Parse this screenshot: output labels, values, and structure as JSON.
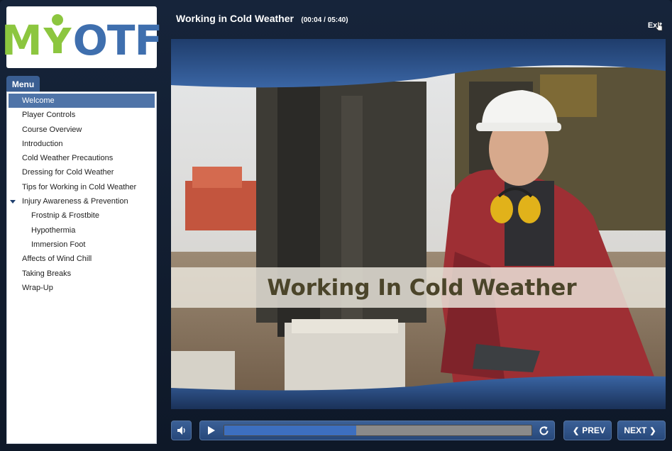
{
  "logo": {
    "text_m": "M",
    "text_y": "Y",
    "text_otf": "OTF"
  },
  "menu": {
    "tab_label": "Menu",
    "items": [
      {
        "label": "Welcome",
        "level": 0,
        "active": true
      },
      {
        "label": "Player Controls",
        "level": 0
      },
      {
        "label": "Course Overview",
        "level": 0
      },
      {
        "label": "Introduction",
        "level": 0
      },
      {
        "label": "Cold Weather Precautions",
        "level": 0
      },
      {
        "label": "Dressing for Cold Weather",
        "level": 0
      },
      {
        "label": "Tips for Working in Cold Weather",
        "level": 0
      },
      {
        "label": "Injury Awareness & Prevention",
        "level": 0,
        "expanded": true
      },
      {
        "label": "Frostnip & Frostbite",
        "level": 1
      },
      {
        "label": "Hypothermia",
        "level": 1
      },
      {
        "label": "Immersion Foot",
        "level": 1
      },
      {
        "label": "Affects of Wind Chill",
        "level": 0
      },
      {
        "label": "Taking Breaks",
        "level": 0
      },
      {
        "label": "Wrap-Up",
        "level": 0
      }
    ]
  },
  "header": {
    "title": "Working in Cold Weather",
    "timer": "(00:04 / 05:40)",
    "exit_label": "Exit"
  },
  "slide": {
    "banner_title": "Working In Cold Weather"
  },
  "controls": {
    "volume_icon": "speaker-icon",
    "play_icon": "play-icon",
    "replay_icon": "replay-icon",
    "progress": 0.43,
    "prev_label": "PREV",
    "next_label": "NEXT"
  },
  "colors": {
    "accent": "#4f74a8",
    "logo_green": "#8cc63f",
    "logo_blue": "#3f6fae",
    "banner_text": "#4b452a"
  }
}
